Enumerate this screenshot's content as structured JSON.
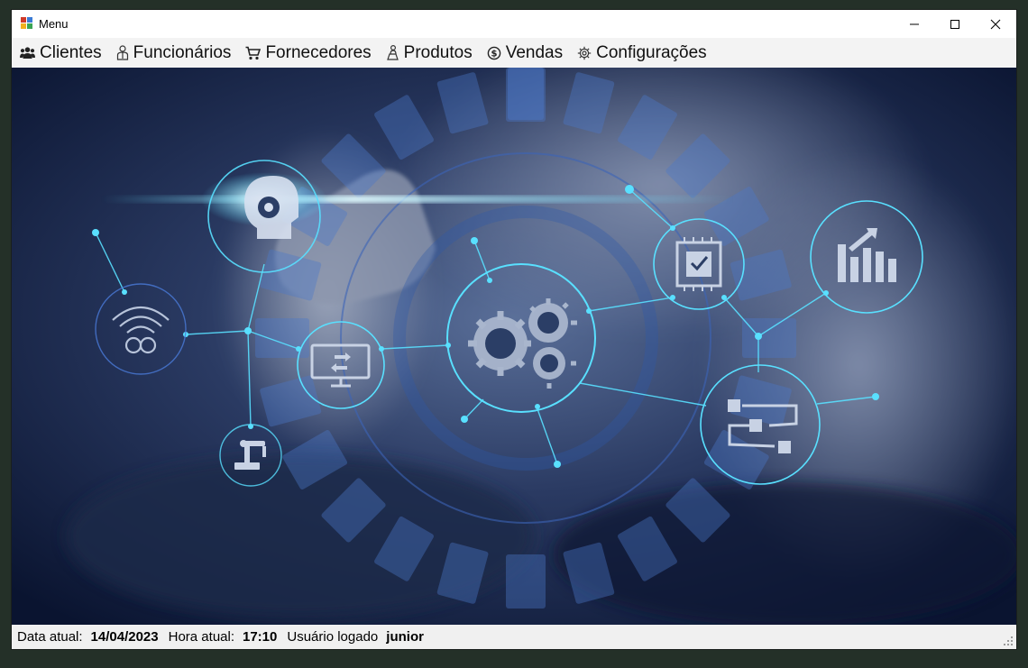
{
  "window": {
    "title": "Menu"
  },
  "menu": {
    "items": [
      {
        "label": "Clientes",
        "icon": "users-icon"
      },
      {
        "label": "Funcionários",
        "icon": "employee-icon"
      },
      {
        "label": "Fornecedores",
        "icon": "cart-icon"
      },
      {
        "label": "Produtos",
        "icon": "product-icon"
      },
      {
        "label": "Vendas",
        "icon": "dollar-coin-icon"
      },
      {
        "label": "Configurações",
        "icon": "gear-icon"
      }
    ]
  },
  "status": {
    "date_label": "Data atual:",
    "date_value": "14/04/2023",
    "time_label": "Hora atual:",
    "time_value": "17:10",
    "user_label": "Usuário logado",
    "user_value": "junior"
  },
  "colors": {
    "background_dark": "#0a1a3a",
    "glow": "#59e0ff",
    "menu_bar": "#f3f3f3",
    "status_bar": "#f0f0f0"
  }
}
